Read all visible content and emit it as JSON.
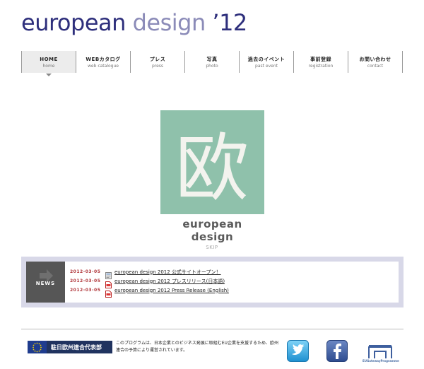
{
  "header": {
    "title_part1": "european",
    "title_part2": " design",
    "title_part3": " ’12"
  },
  "nav": [
    {
      "ja": "HOME",
      "en": "home",
      "active": true
    },
    {
      "ja": "WEBカタログ",
      "en": "web catalogue"
    },
    {
      "ja": "プレス",
      "en": "press"
    },
    {
      "ja": "写真",
      "en": "photo"
    },
    {
      "ja": "過去のイベント",
      "en": "past event"
    },
    {
      "ja": "事前登録",
      "en": "registration"
    },
    {
      "ja": "お問い合わせ",
      "en": "contact"
    }
  ],
  "emblem": {
    "kanji": "欧",
    "caption": "european design",
    "color": "#8fc1ab"
  },
  "skip_label": "SKIP",
  "news": {
    "label": "NEWS",
    "items": [
      {
        "date": "2012-03-05",
        "icon": "web-page-icon",
        "text": "european design 2012 公式サイトオープン！"
      },
      {
        "date": "2012-03-05",
        "icon": "pdf-icon",
        "text": "european design 2012 プレスリリース(日本語)"
      },
      {
        "date": "2012-03-05",
        "icon": "pdf-icon",
        "text": "european design 2012 Press Release (English)"
      }
    ]
  },
  "footer": {
    "badge_label": "駐日欧州連合代表部",
    "description": "このプログラムは、日本企業とのビジネス発展に取組むEU企業を支援するため、欧州連合の予算により運営されています。",
    "egp_label": "EUGatewayProgramme"
  },
  "colors": {
    "brand_navy": "#2e2f7c",
    "brand_lavender": "#8b8bb8",
    "date_red": "#b0363a"
  }
}
